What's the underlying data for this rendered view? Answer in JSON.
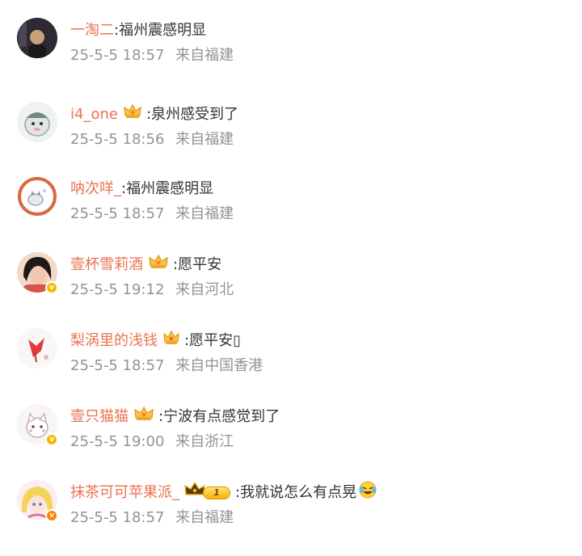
{
  "colors": {
    "username": "#eb7350",
    "comment_text": "#333333",
    "meta_text": "#939393",
    "verified_yellow": "#f5b800",
    "verified_orange": "#ff8200"
  },
  "comments": [
    {
      "username": "一淘二",
      "text": ":福州震感明显",
      "time": "25-5-5 18:57",
      "location": "来自福建",
      "avatar_icon": "user-photo-icon",
      "badge": null
    },
    {
      "username": "i4_one",
      "text": ":泉州感受到了",
      "time": "25-5-5 18:56",
      "location": "来自福建",
      "avatar_icon": "cartoon-avatar-icon",
      "badge": "crown-icon"
    },
    {
      "username": "呐次咩_",
      "text": ":福州震感明显",
      "time": "25-5-5 18:57",
      "location": "来自福建",
      "avatar_icon": "cat-avatar-icon",
      "badge": null
    },
    {
      "username": "壹杯雪莉酒",
      "text": ":愿平安",
      "time": "25-5-5 19:12",
      "location": "来自河北",
      "avatar_icon": "user-photo-icon",
      "badge": "crown-icon",
      "verified": "yellow"
    },
    {
      "username": "梨涡里的浅钱",
      "text": ":愿平安▯",
      "time": "25-5-5 18:57",
      "location": "来自中国香港",
      "avatar_icon": "cartoon-avatar-icon",
      "badge": "crown-icon"
    },
    {
      "username": "壹只猫猫",
      "text": ":宁波有点感觉到了",
      "time": "25-5-5 19:00",
      "location": "来自浙江",
      "avatar_icon": "cat-avatar-icon",
      "badge": "crown-icon",
      "verified": "yellow"
    },
    {
      "username": "抹茶可可苹果派_",
      "text": ":我就说怎么有点晃",
      "time": "25-5-5 18:57",
      "location": "来自福建",
      "avatar_icon": "anime-avatar-icon",
      "badge": "level-crown-icon",
      "badge_level": "1",
      "verified": "orange",
      "emoji": "laughing-crying-emoji-icon"
    }
  ]
}
